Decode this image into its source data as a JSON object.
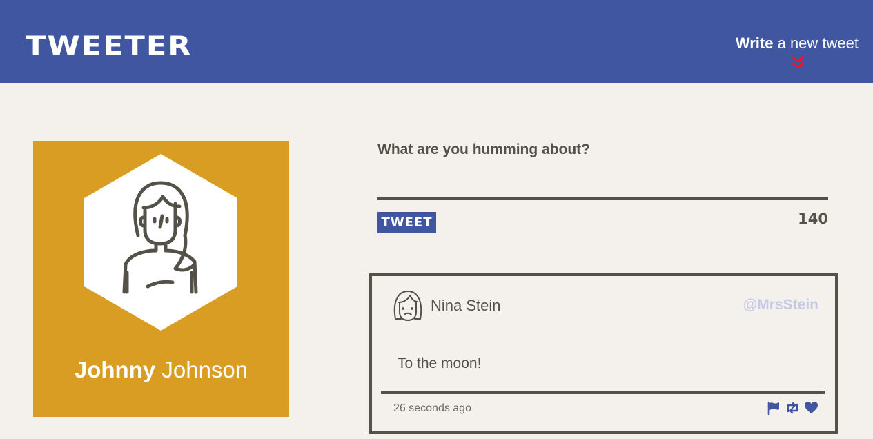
{
  "header": {
    "logo": "TWEETER",
    "compose_strong": "Write",
    "compose_light": " a new tweet",
    "accent_color": "#4056a1",
    "chevron_color": "#e8192c"
  },
  "profile": {
    "first_name": "Johnny",
    "last_name": " Johnson",
    "card_color": "#d99d24",
    "avatar_icon": "woman-avatar-icon"
  },
  "composer": {
    "prompt": "What are you humming about?",
    "input_value": "",
    "button_label": "TWEET",
    "char_count": "140"
  },
  "tweets": [
    {
      "author": "Nina Stein",
      "handle": "@MrsStein",
      "body": "To the moon!",
      "time": "26 seconds ago",
      "avatar_icon": "sad-woman-avatar-icon",
      "actions": [
        "flag-icon",
        "retweet-icon",
        "heart-icon"
      ]
    }
  ]
}
